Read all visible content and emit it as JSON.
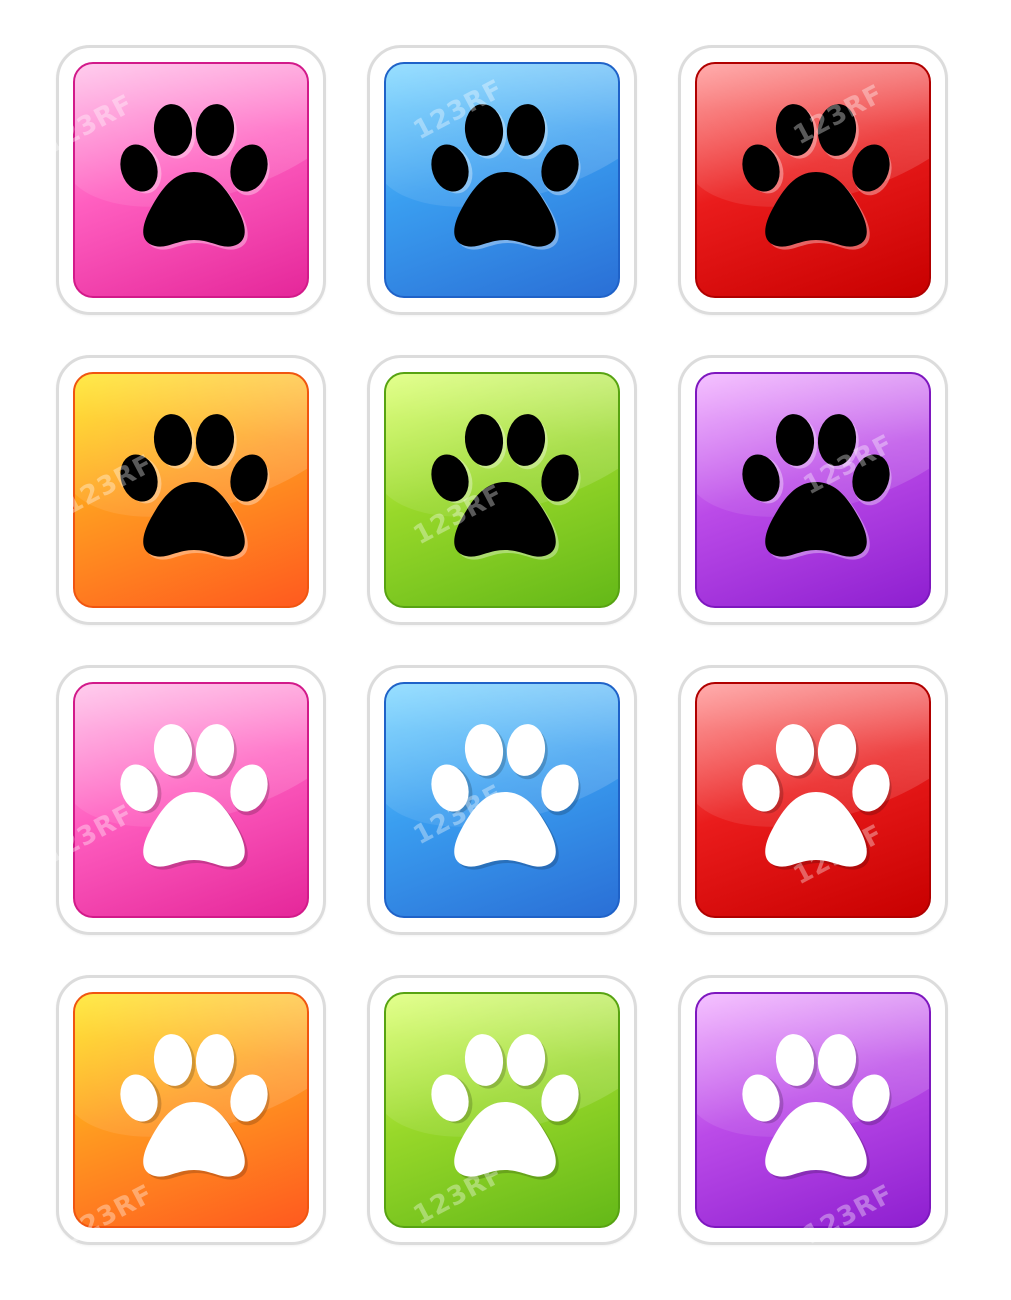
{
  "watermark": "123RF",
  "paw_icons": [
    {
      "name": "paw-icon-black-pink",
      "tile": {
        "light": "#ffb8e6",
        "mid": "#ff5fc0",
        "dark": "#e5279a",
        "edge": "#d21a8a"
      },
      "paw_color": "#000000"
    },
    {
      "name": "paw-icon-black-blue",
      "tile": {
        "light": "#6fd2ff",
        "mid": "#3a9ef0",
        "dark": "#2a6fd6",
        "edge": "#1f62c8"
      },
      "paw_color": "#000000"
    },
    {
      "name": "paw-icon-black-red",
      "tile": {
        "light": "#ff8b8b",
        "mid": "#ea1c1c",
        "dark": "#c80000",
        "edge": "#b00000"
      },
      "paw_color": "#000000"
    },
    {
      "name": "paw-icon-black-orange",
      "tile": {
        "light": "#ffe100",
        "mid": "#ff9a20",
        "dark": "#ff5a1f",
        "edge": "#f05510"
      },
      "paw_color": "#000000"
    },
    {
      "name": "paw-icon-black-green",
      "tile": {
        "light": "#d7ff60",
        "mid": "#98d82a",
        "dark": "#64b818",
        "edge": "#57a312"
      },
      "paw_color": "#000000"
    },
    {
      "name": "paw-icon-black-purple",
      "tile": {
        "light": "#f0a8ff",
        "mid": "#bb4be8",
        "dark": "#8e1fd0",
        "edge": "#7e17bf"
      },
      "paw_color": "#000000"
    },
    {
      "name": "paw-icon-white-pink",
      "tile": {
        "light": "#ffb8e6",
        "mid": "#ff5fc0",
        "dark": "#e5279a",
        "edge": "#d21a8a"
      },
      "paw_color": "#ffffff"
    },
    {
      "name": "paw-icon-white-blue",
      "tile": {
        "light": "#6fd2ff",
        "mid": "#3a9ef0",
        "dark": "#2a6fd6",
        "edge": "#1f62c8"
      },
      "paw_color": "#ffffff"
    },
    {
      "name": "paw-icon-white-red",
      "tile": {
        "light": "#ff8b8b",
        "mid": "#ea1c1c",
        "dark": "#c80000",
        "edge": "#b00000"
      },
      "paw_color": "#ffffff"
    },
    {
      "name": "paw-icon-white-orange",
      "tile": {
        "light": "#ffe100",
        "mid": "#ff9a20",
        "dark": "#ff5a1f",
        "edge": "#f05510"
      },
      "paw_color": "#ffffff"
    },
    {
      "name": "paw-icon-white-green",
      "tile": {
        "light": "#d7ff60",
        "mid": "#98d82a",
        "dark": "#64b818",
        "edge": "#57a312"
      },
      "paw_color": "#ffffff"
    },
    {
      "name": "paw-icon-white-purple",
      "tile": {
        "light": "#f0a8ff",
        "mid": "#bb4be8",
        "dark": "#8e1fd0",
        "edge": "#7e17bf"
      },
      "paw_color": "#ffffff"
    }
  ]
}
